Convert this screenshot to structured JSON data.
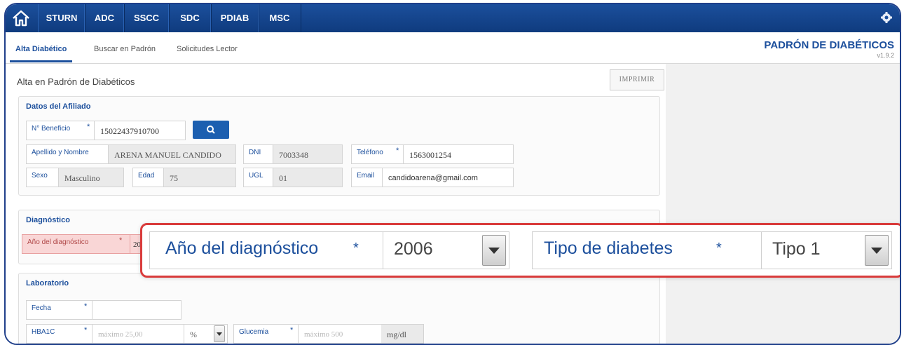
{
  "nav": {
    "tabs": [
      "STURN",
      "ADC",
      "SSCC",
      "SDC",
      "PDIAB",
      "MSC"
    ]
  },
  "subnav": {
    "tabs": [
      "Alta Diabético",
      "Buscar en Padrón",
      "Solicitudes Lector"
    ],
    "active": 0
  },
  "app": {
    "title": "PADRÓN DE DIABÉTICOS",
    "version": "v1.9.2"
  },
  "page": {
    "title": "Alta en Padrón de Diabéticos",
    "print_label": "IMPRIMIR"
  },
  "afiliado": {
    "heading": "Datos del Afiliado",
    "beneficio_label": "N° Beneficio",
    "beneficio_value": "15022437910700",
    "nombre_label": "Apellido y Nombre",
    "nombre_value": "ARENA MANUEL CANDIDO",
    "dni_label": "DNI",
    "dni_value": "7003348",
    "telefono_label": "Teléfono",
    "telefono_value": "1563001254",
    "sexo_label": "Sexo",
    "sexo_value": "Masculino",
    "edad_label": "Edad",
    "edad_value": "75",
    "ugl_label": "UGL",
    "ugl_value": "01",
    "email_label": "Email",
    "email_value": "candidoarena@gmail.com"
  },
  "diagnostico": {
    "heading": "Diagnóstico",
    "anio_label": "Año del diagnóstico",
    "anio_value_partial": "20"
  },
  "laboratorio": {
    "heading": "Laboratorio",
    "fecha_label": "Fecha",
    "fecha_value": "",
    "hba1c_label": "HBA1C",
    "hba1c_placeholder": "máximo 25,00",
    "hba1c_unit": "%",
    "glucemia_label": "Glucemia",
    "glucemia_placeholder": "máximo 500",
    "glucemia_unit": "mg/dl"
  },
  "zoom": {
    "anio_label": "Año del diagnóstico",
    "anio_value": "2006",
    "tipo_label": "Tipo de diabetes",
    "tipo_value": "Tipo 1"
  },
  "required_mark": "*",
  "colors": {
    "nav": "#1b4f9c",
    "accent": "#1c4f9c",
    "error": "#d93b3b"
  },
  "icons": {
    "home": "home-icon",
    "settings": "gear-icon",
    "search": "search-icon"
  }
}
